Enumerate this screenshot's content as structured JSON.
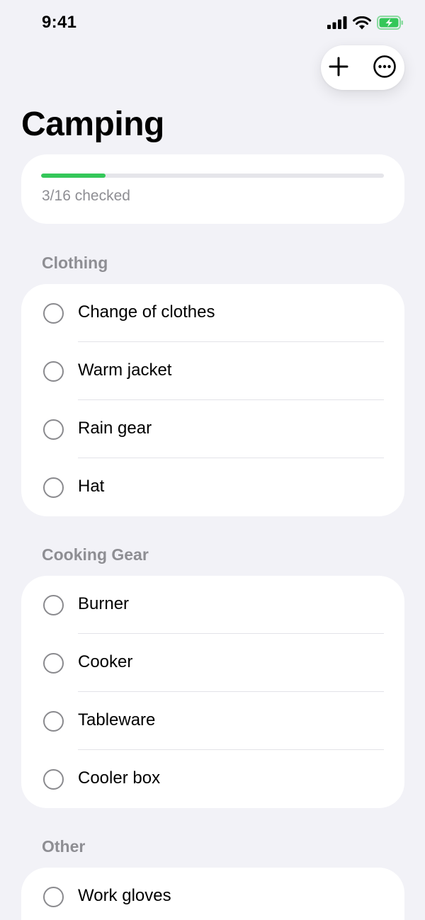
{
  "status_bar": {
    "time": "9:41"
  },
  "title": "Camping",
  "progress": {
    "text": "3/16 checked",
    "checked": 3,
    "total": 16,
    "fill_fraction": 0.1875
  },
  "colors": {
    "accent": "#34c759",
    "background": "#f2f2f7",
    "secondary_text": "#8e8e93"
  },
  "sections": [
    {
      "header": "Clothing",
      "items": [
        {
          "label": "Change of clothes",
          "checked": false
        },
        {
          "label": "Warm jacket",
          "checked": false
        },
        {
          "label": "Rain gear",
          "checked": false
        },
        {
          "label": "Hat",
          "checked": false
        }
      ]
    },
    {
      "header": "Cooking Gear",
      "items": [
        {
          "label": "Burner",
          "checked": false
        },
        {
          "label": "Cooker",
          "checked": false
        },
        {
          "label": "Tableware",
          "checked": false
        },
        {
          "label": "Cooler box",
          "checked": false
        }
      ]
    },
    {
      "header": "Other",
      "items": [
        {
          "label": "Work gloves",
          "checked": false
        }
      ]
    }
  ],
  "icons": {
    "add": "plus-icon",
    "more": "ellipsis-circle-icon"
  }
}
